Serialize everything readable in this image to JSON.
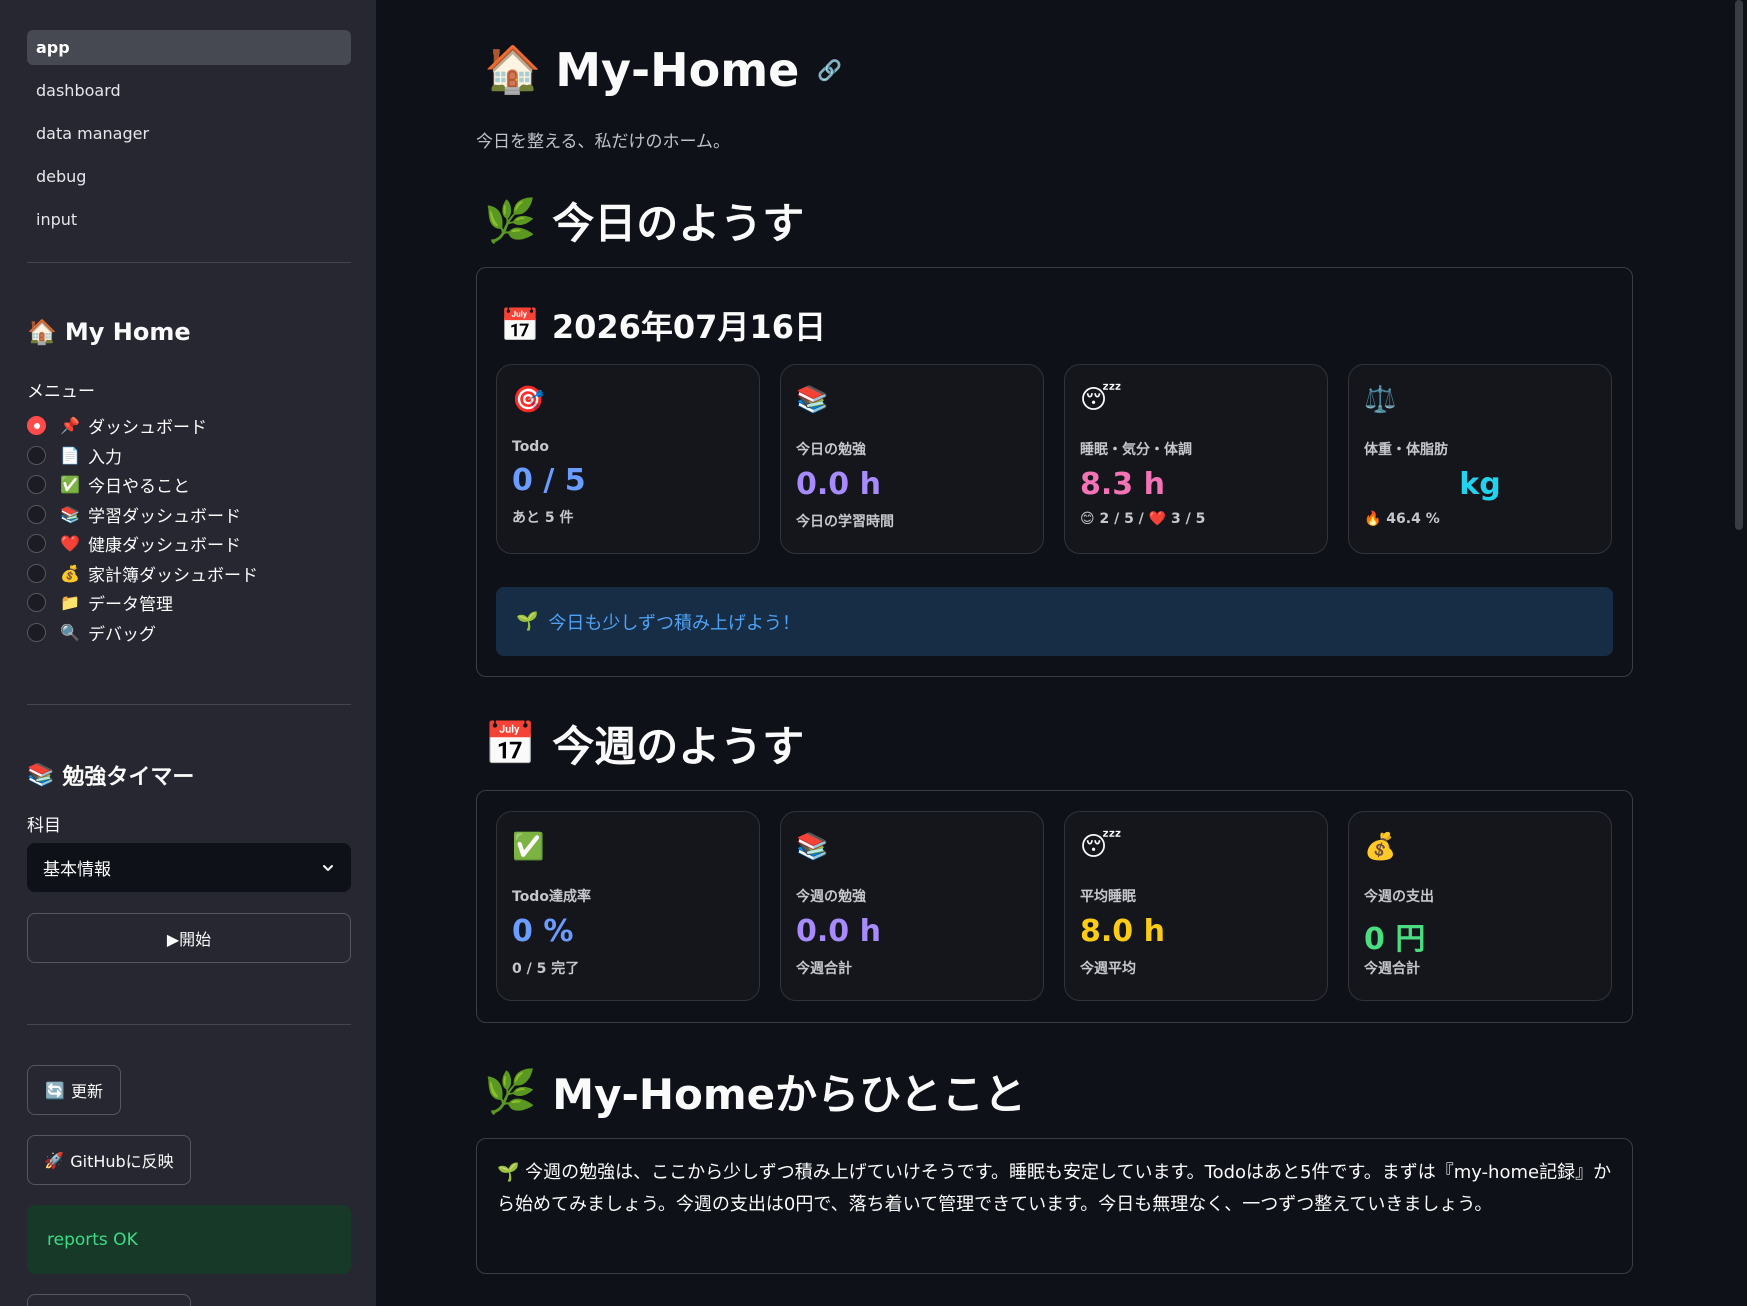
{
  "sidebar": {
    "pages": [
      "app",
      "dashboard",
      "data manager",
      "debug",
      "input"
    ],
    "active_page": "app",
    "title_icon": "🏠",
    "title": "My Home",
    "menu_label": "メニュー",
    "menu_items": [
      {
        "icon": "📌",
        "label": "ダッシュボード",
        "selected": true
      },
      {
        "icon": "📄",
        "label": "入力",
        "selected": false
      },
      {
        "icon": "✅",
        "label": "今日やること",
        "selected": false
      },
      {
        "icon": "📚",
        "label": "学習ダッシュボード",
        "selected": false
      },
      {
        "icon": "❤️",
        "label": "健康ダッシュボード",
        "selected": false
      },
      {
        "icon": "💰",
        "label": "家計簿ダッシュボード",
        "selected": false
      },
      {
        "icon": "📁",
        "label": "データ管理",
        "selected": false
      },
      {
        "icon": "🔍",
        "label": "デバッグ",
        "selected": false
      }
    ],
    "timer": {
      "icon": "📚",
      "title": "勉強タイマー",
      "subject_label": "科目",
      "subject_value": "基本情報",
      "start_label": "▶開始"
    },
    "refresh_icon": "🔄",
    "refresh_label": "更新",
    "github_icon": "🚀",
    "github_label": "GitHubに反映",
    "status_text": "reports OK"
  },
  "main": {
    "title_icon": "🏠",
    "title": "My-Home",
    "link_icon": "🔗",
    "subtitle": "今日を整える、私だけのホーム。",
    "today": {
      "icon": "🌿",
      "heading": "今日のようす",
      "date_icon": "📅",
      "date": "2026年07月16日",
      "cards": [
        {
          "icon": "🎯",
          "label": "Todo",
          "value": "0 / 5",
          "sub": "あと 5 件",
          "color": "#6b9cff"
        },
        {
          "icon": "📚",
          "label": "今日の勉強",
          "value": "0.0 h",
          "sub": "今日の学習時間",
          "color": "#a78bfa"
        },
        {
          "icon": "😴",
          "label": "睡眠・気分・体調",
          "value": "8.3 h",
          "sub": "😊 2 / 5 / ❤️ 3 / 5",
          "color": "#f472b6"
        },
        {
          "icon": "⚖️",
          "label": "体重・体脂肪",
          "value": "kg",
          "sub": "🔥 46.4 %",
          "color": "#22d3ee"
        }
      ],
      "info_icon": "🌱",
      "info_text": "今日も少しずつ積み上げよう！"
    },
    "week": {
      "icon": "📅",
      "heading": "今週のようす",
      "cards": [
        {
          "icon": "✅",
          "label": "Todo達成率",
          "value": "0 %",
          "sub": "0 / 5 完了",
          "color": "#6b9cff"
        },
        {
          "icon": "📚",
          "label": "今週の勉強",
          "value": "0.0 h",
          "sub": "今週合計",
          "color": "#a78bfa"
        },
        {
          "icon": "😴",
          "label": "平均睡眠",
          "value": "8.0 h",
          "sub": "今週平均",
          "color": "#facc15"
        },
        {
          "icon": "💰",
          "label": "今週の支出",
          "value": "0 円",
          "sub": "今週合計",
          "color": "#4ade80"
        }
      ]
    },
    "message": {
      "icon": "🌿",
      "heading": "My-Homeからひとこと",
      "text_icon": "🌱",
      "text": "今週の勉強は、ここから少しずつ積み上げていけそうです。睡眠も安定しています。Todoはあと5件です。まずは『my-home記録』から始めてみましょう。今週の支出は0円で、落ち着いて管理できています。今日も無理なく、一つずつ整えていきましょう。"
    }
  }
}
